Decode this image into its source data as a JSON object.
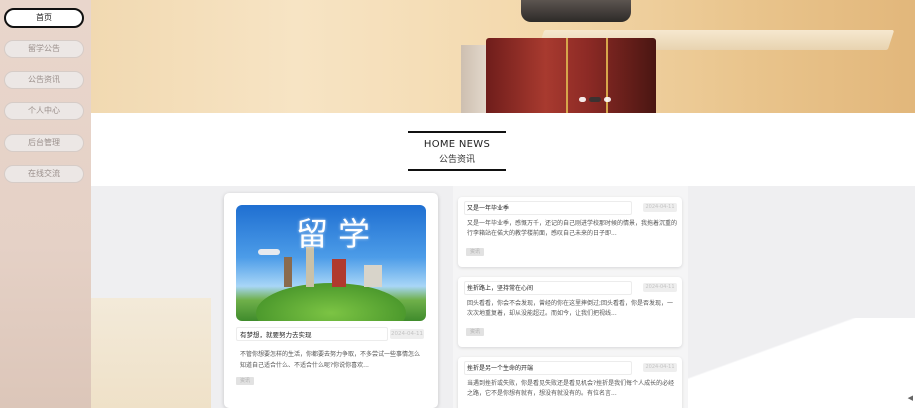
{
  "sidebar": {
    "items": [
      {
        "label": "首页",
        "active": true
      },
      {
        "label": "留学公告",
        "active": false
      },
      {
        "label": "公告资讯",
        "active": false
      },
      {
        "label": "个人中心",
        "active": false
      },
      {
        "label": "后台管理",
        "active": false
      },
      {
        "label": "在线交流",
        "active": false
      }
    ]
  },
  "section": {
    "title_en": "HOME NEWS",
    "title_cn": "公告资讯"
  },
  "feature": {
    "image_text": "留学",
    "title": "有梦想，就要努力去实现",
    "date": "2024-04-11",
    "body": "不管你想要怎样的生活，你都要去努力争取，不多尝试一些事情怎么知道自己适合什么、不适合什么呢?你说你喜欢...",
    "tag": "资讯"
  },
  "news": [
    {
      "title": "又是一年毕业季",
      "date": "2024-04-11",
      "body": "又是一年毕业季，感慨万千，还记的自己刚进学校那时候的情景，我拖着沉重的行李箱站在偌大的教学楼前面，感叹自己未来的日子即...",
      "tag": "资讯"
    },
    {
      "title": "挫折路上，坚持常在心间",
      "date": "2024-04-11",
      "body": "回头看看，你会不会发现，曾经的你在这里摔倒过;回头看看，你是否发现，一次次地重复着，却从没能超过。而如今，让我们把视线...",
      "tag": "资讯"
    },
    {
      "title": "挫折是另一个生命的开端",
      "date": "2024-04-11",
      "body": "当遇到挫折或失败，你是看见失败还是看见机会?挫折是我们每个人成长的必经之路，它不是你想有就有，想没有就没有的。有位名言...",
      "tag": "资讯"
    }
  ]
}
